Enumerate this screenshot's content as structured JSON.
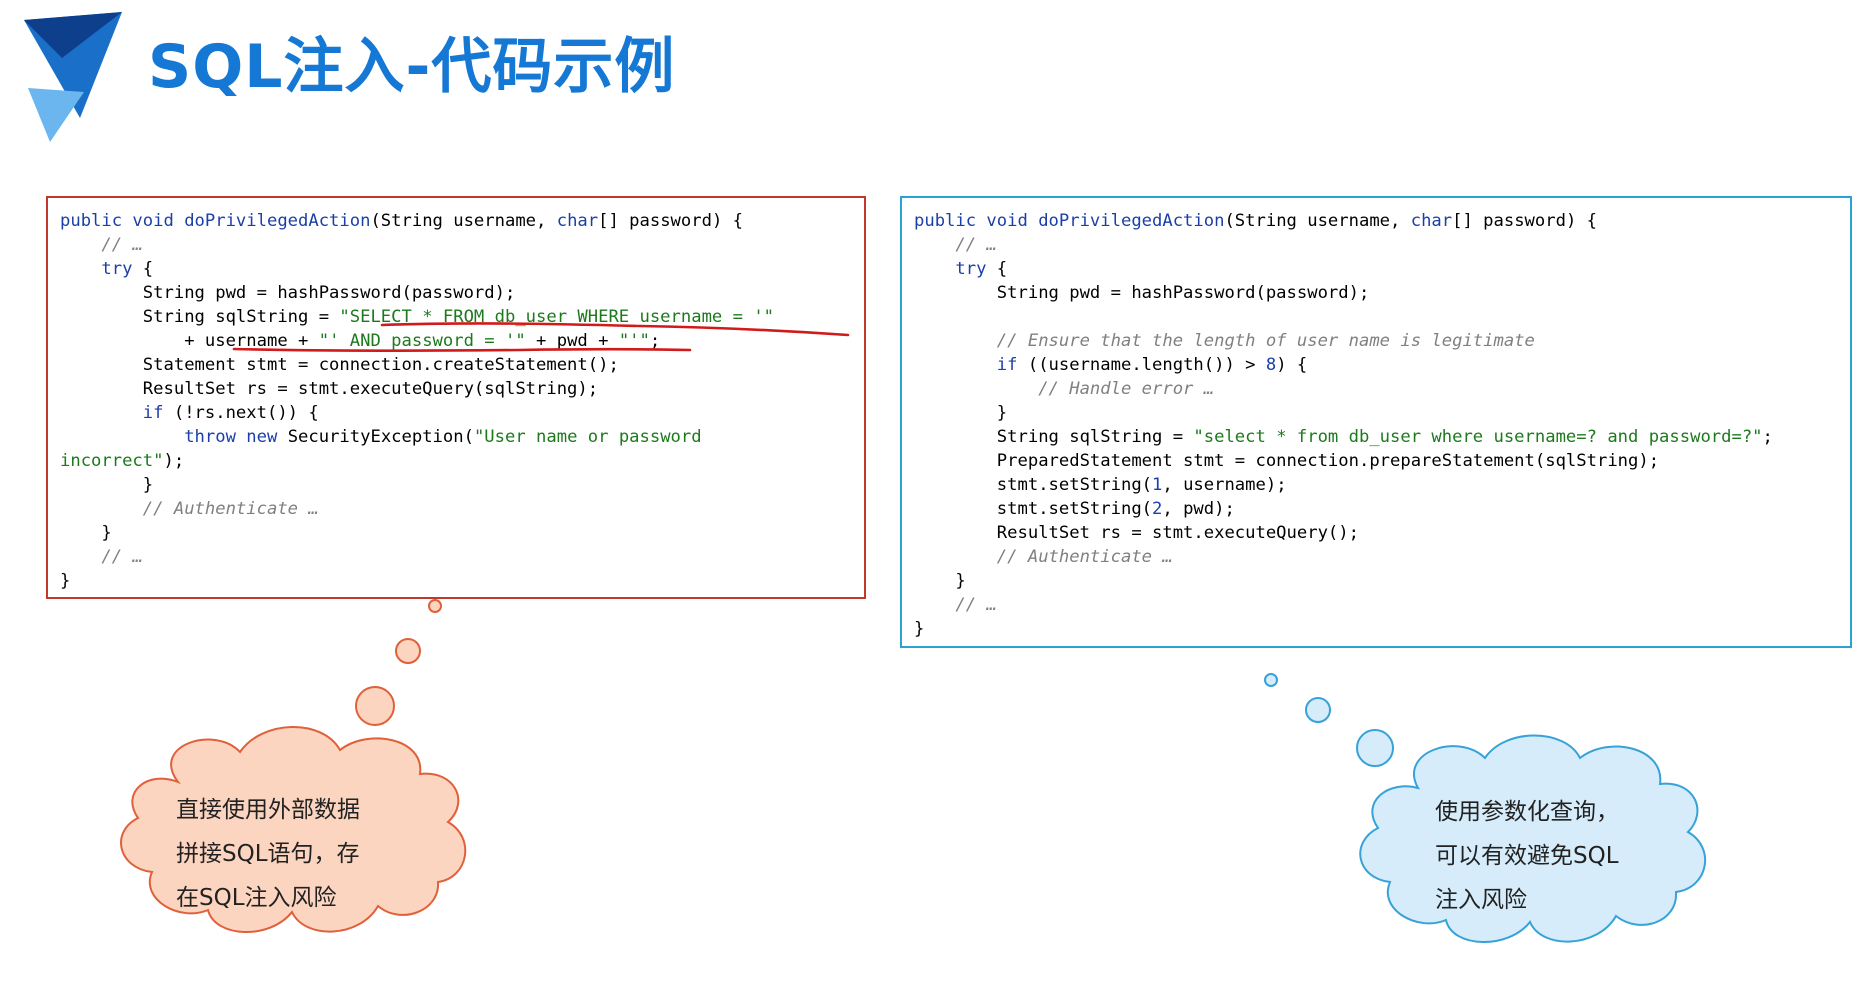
{
  "slide": {
    "title": "SQL注入-代码示例"
  },
  "left_code": {
    "l1_a": "public void ",
    "l1_b": "doPrivilegedAction",
    "l1_c": "(String username, ",
    "l1_d": "char",
    "l1_e": "[] password) {",
    "l2": "// …",
    "l3_kw": "try",
    "l3_rest": " {",
    "l4": "String pwd = hashPassword(password);",
    "l5_a": "String sqlString = ",
    "l5_str": "\"SELECT * FROM db_user WHERE username = '\"",
    "l6_a": "+ username + ",
    "l6_str1": "\"' AND password = '\"",
    "l6_b": " + pwd + ",
    "l6_str2": "\"'\"",
    "l6_c": ";",
    "l7": "Statement stmt = connection.createStatement();",
    "l8": "ResultSet rs = stmt.executeQuery(sqlString);",
    "l9_kw": "if",
    "l9_rest": " (!rs.next()) {",
    "l10_kw1": "throw",
    "l10_kw2": "new",
    "l10_rest": " SecurityException(",
    "l10_str": "\"User name or password",
    "l11_str": "incorrect\"",
    "l11_rest": ");",
    "l12": "}",
    "l13": "// Authenticate …",
    "l14": "}",
    "l15": "// …",
    "l16": "}"
  },
  "right_code": {
    "l1_a": "public void ",
    "l1_b": "doPrivilegedAction",
    "l1_c": "(String username, ",
    "l1_d": "char",
    "l1_e": "[] password) {",
    "l2": "// …",
    "l3_kw": "try",
    "l3_rest": " {",
    "l4": "String pwd = hashPassword(password);",
    "l6": "// Ensure that the length of user name is legitimate",
    "l7_kw": "if",
    "l7_a": " ((username.length()) > ",
    "l7_num": "8",
    "l7_b": ") {",
    "l8": "// Handle error …",
    "l9": "}",
    "l10_a": "String sqlString = ",
    "l10_str": "\"select * from db_user where username=? and password=?\"",
    "l10_b": ";",
    "l11": "PreparedStatement stmt = connection.prepareStatement(sqlString);",
    "l12_a": "stmt.setString(",
    "l12_num": "1",
    "l12_b": ", username);",
    "l13_a": "stmt.setString(",
    "l13_num": "2",
    "l13_b": ", pwd);",
    "l14": "ResultSet rs = stmt.executeQuery();",
    "l15": "// Authenticate …",
    "l16": "}",
    "l17": "// …",
    "l18": "}"
  },
  "callouts": {
    "left": [
      "直接使用外部数据",
      "拼接SQL语句，存",
      "在SQL注入风险"
    ],
    "right": [
      "使用参数化查询，",
      "可以有效避免SQL",
      "注入风险"
    ]
  },
  "colors": {
    "title": "#1478d4",
    "left_border": "#c0392b",
    "right_border": "#29a3d4",
    "left_cloud_fill": "#fcd5c0",
    "left_cloud_stroke": "#e0603a",
    "right_cloud_fill": "#d6ecfa",
    "right_cloud_stroke": "#36a2d8",
    "underline": "#d11a1a"
  }
}
